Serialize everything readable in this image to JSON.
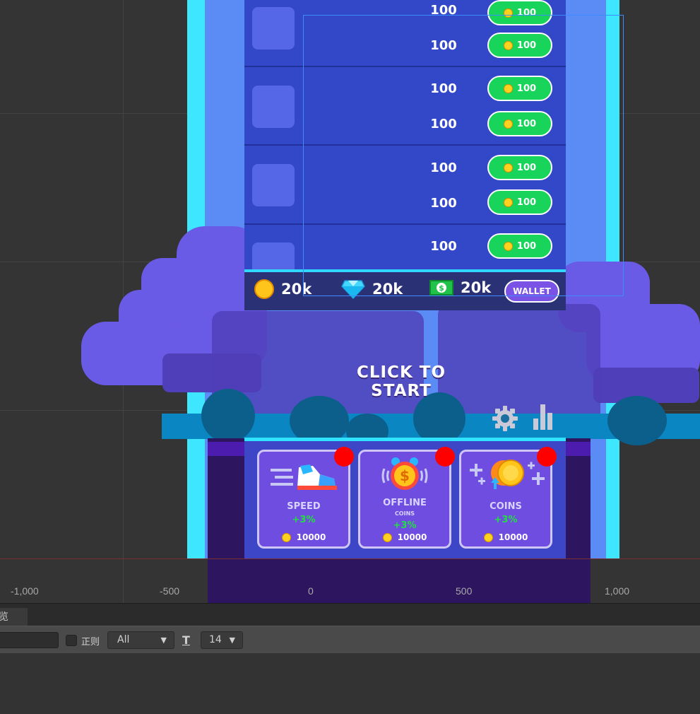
{
  "scene": {
    "axis_labels": [
      "-1,000",
      "-500",
      "0",
      "500",
      "1,000"
    ],
    "shop_rows": [
      {
        "amount_1": "100",
        "price_1": "100",
        "amount_2": "100",
        "price_2": "100"
      },
      {
        "amount_1": "100",
        "price_1": "100",
        "amount_2": "100",
        "price_2": "100"
      },
      {
        "amount_1": "100",
        "price_1": "100",
        "amount_2": "100",
        "price_2": "100"
      },
      {
        "amount_1": "100",
        "price_1": "100"
      }
    ],
    "currency": {
      "coins": "20k",
      "gems": "20k",
      "cash": "20k",
      "wallet_label": "WALLET"
    },
    "start_label": "CLICK TO START",
    "upgrades": [
      {
        "title": "SPEED",
        "subtitle": "",
        "bonus": "+3%",
        "price": "10000",
        "icon": "sneaker-icon"
      },
      {
        "title": "OFFLINE",
        "subtitle": "COINS",
        "bonus": "+3%",
        "price": "10000",
        "icon": "alarm-clock-coin-icon"
      },
      {
        "title": "COINS",
        "subtitle": "",
        "bonus": "+3%",
        "price": "10000",
        "icon": "coin-stack-icon"
      }
    ],
    "colors": {
      "buy_button": "#18d45a",
      "notification_dot": "#ff0000",
      "bonus_text": "#22e040"
    }
  },
  "editor": {
    "tab_label": "览",
    "search_value": "",
    "regex_label": "正则",
    "filter_select": "All",
    "font_size_select": "14"
  }
}
